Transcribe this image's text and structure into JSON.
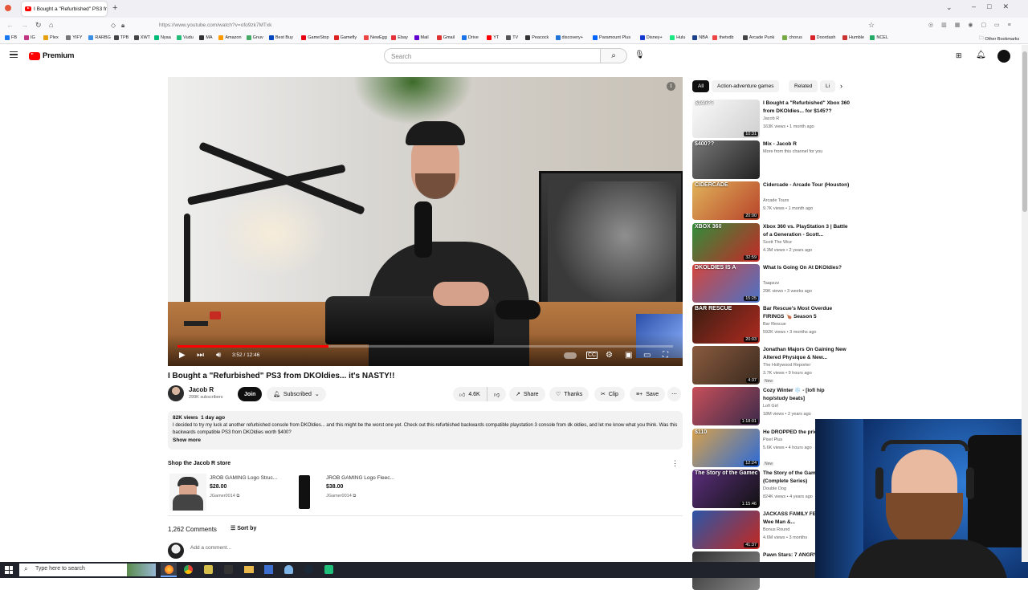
{
  "browser": {
    "tab_title": "I Bought a \"Refurbished\" PS3 fr",
    "url": "https://www.youtube.com/watch?v=ofo9zk7MTxk",
    "bookmarks": [
      "FB",
      "IG",
      "Plex",
      "YIFY",
      "RARBG",
      "TPB",
      "XWT",
      "Nyaa",
      "Vudu",
      "MA",
      "Amazon",
      "Gnuv",
      "Best Buy",
      "GameStop",
      "Gamefly",
      "NewEgg",
      "Ebay",
      "Mail",
      "Gmail",
      "Drive",
      "YT",
      "TV",
      "Peacock",
      "discovery+",
      "Paramount Plus",
      "Disney+",
      "Hulu",
      "NBA",
      "thetvdb",
      "Arcade Punk",
      "chorus",
      "Doordash",
      "Humble",
      "NCEL"
    ],
    "other_bookmarks": "Other Bookmarks"
  },
  "youtube": {
    "logo_text": "Premium",
    "search_placeholder": "Search",
    "player": {
      "time": "3:52 / 12:46",
      "progress": 0.305,
      "info": "i"
    },
    "video": {
      "title": "I Bought a \"Refurbished\" PS3 from DKOldies... it's NASTY!!",
      "channel": "Jacob R",
      "subscribers": "299K subscribers",
      "join": "Join",
      "subscribed": "Subscribed",
      "likes": "4.6K",
      "share": "Share",
      "thanks": "Thanks",
      "clip": "Clip",
      "save": "Save",
      "views": "82K views",
      "age": "1 day ago",
      "description": "I decided to try my luck at another refurbished console from DKOldies... and this might be the worst one yet. Check out this refurbished backwards compatible playstation 3 console from dk oldies, and let me know what you think. Was this backwards compatible PS3 from DKOldies worth $400?",
      "show_more": "Show more"
    },
    "store": {
      "heading": "Shop the Jacob R store",
      "products": [
        {
          "name": "JROB GAMING Logo Struc...",
          "price": "$28.00",
          "seller": "JGamer0014"
        },
        {
          "name": "JROB GAMING Logo Fleec...",
          "price": "$38.00",
          "seller": "JGamer0014"
        }
      ]
    },
    "comments": {
      "count": "1,262 Comments",
      "sort": "Sort by",
      "add_placeholder": "Add a comment..."
    },
    "chips": [
      "All",
      "Action-adventure games",
      "Related",
      "Li"
    ],
    "related": [
      {
        "title": "I Bought a \"Refurbished\" Xbox 360 from DKOldies... for $145??",
        "channel": "Jacob R",
        "meta": "163K views • 1 month ago",
        "duration": "10:31",
        "thumb_text": "$145??"
      },
      {
        "title": "Mix - Jacob R",
        "channel": "More from this channel for you",
        "meta": "",
        "duration": "",
        "thumb_text": "$400??"
      },
      {
        "title": "Cidercade - Arcade Tour (Houston)",
        "channel": "Arcade Tours",
        "meta": "9.7K views • 1 month ago",
        "duration": "20:00",
        "thumb_text": "CIDERCADE"
      },
      {
        "title": "Xbox 360 vs. PlayStation 3 | Battle of a Generation - Scott...",
        "channel": "Scott The Woz",
        "meta": "4.3M views • 2 years ago",
        "duration": "32:59",
        "thumb_text": "XBOX 360"
      },
      {
        "title": "What Is Going On At DKOldies?",
        "channel": "Taapzzz",
        "meta": "29K views • 3 weeks ago",
        "duration": "15:25",
        "thumb_text": "DKOLDIES IS A"
      },
      {
        "title": "Bar Rescue's Most Overdue FIRINGS 🍗 Season 5",
        "channel": "Bar Rescue",
        "meta": "592K views • 3 months ago",
        "duration": "20:03",
        "thumb_text": "BAR RESCUE"
      },
      {
        "title": "Jonathan Majors On Gaining New Altered Physique & New...",
        "channel": "The Hollywood Reporter",
        "meta": "3.7K views • 9 hours ago",
        "duration": "4:37",
        "thumb_text": "",
        "badge": "New"
      },
      {
        "title": "Cozy Winter ❄️ - [lofi hip hop/study beats]",
        "channel": "Lofi Girl",
        "meta": "18M views • 2 years ago",
        "duration": "1:18:01",
        "thumb_text": ""
      },
      {
        "title": "He DROPPED the price FAST",
        "channel": "Pixel Plus",
        "meta": "5.6K views • 4 hours ago",
        "duration": "12:24",
        "thumb_text": "$110",
        "badge": "New"
      },
      {
        "title": "The Story of the Gamecube (Complete Series)",
        "channel": "Double Dog",
        "meta": "824K views • 4 years ago",
        "duration": "1:15:46",
        "thumb_text": "The Story of the Gamecube"
      },
      {
        "title": "JACKASS FAMILY FEUD Knoxville, Wee Man &...",
        "channel": "Bonus Round",
        "meta": "4.6M views • 3 months",
        "duration": "41:37",
        "thumb_text": ""
      },
      {
        "title": "Pawn Stars: 7 ANGRY",
        "channel": "",
        "meta": "",
        "duration": "",
        "thumb_text": ""
      }
    ]
  },
  "taskbar": {
    "search_placeholder": "Type here to search"
  }
}
